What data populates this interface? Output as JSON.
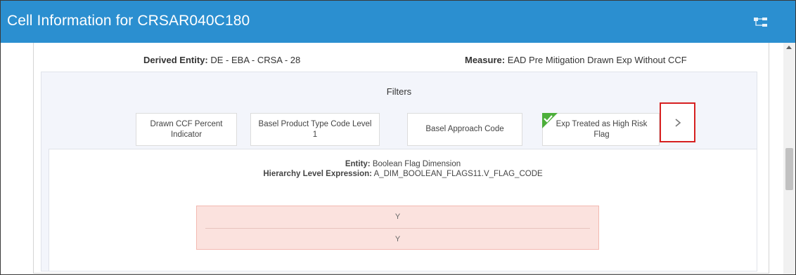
{
  "window": {
    "title": "Cell Information for CRSAR040C180"
  },
  "header": {
    "derived_entity_label": "Derived Entity:",
    "derived_entity_value": "DE - EBA - CRSA - 28",
    "measure_label": "Measure:",
    "measure_value": "EAD Pre Mitigation Drawn Exp Without CCF"
  },
  "filters": {
    "title": "Filters",
    "items": [
      {
        "label": "Drawn CCF Percent Indicator",
        "checked": false
      },
      {
        "label": "Basel Product Type Code Level 1",
        "checked": false
      },
      {
        "label": "Basel Approach Code",
        "checked": false
      },
      {
        "label": "Exp Treated as High Risk Flag",
        "checked": true
      }
    ],
    "next_icon": "chevron-right-icon"
  },
  "detail": {
    "entity_label": "Entity:",
    "entity_value": "Boolean Flag Dimension",
    "hierarchy_label": "Hierarchy Level Expression:",
    "hierarchy_value": "A_DIM_BOOLEAN_FLAGS11.V_FLAG_CODE",
    "values": [
      "Y",
      "Y"
    ]
  },
  "colors": {
    "titlebar": "#2b8fd0",
    "check": "#4caf3a",
    "highlight_border": "#d62020",
    "values_bg": "#fbe2de"
  }
}
